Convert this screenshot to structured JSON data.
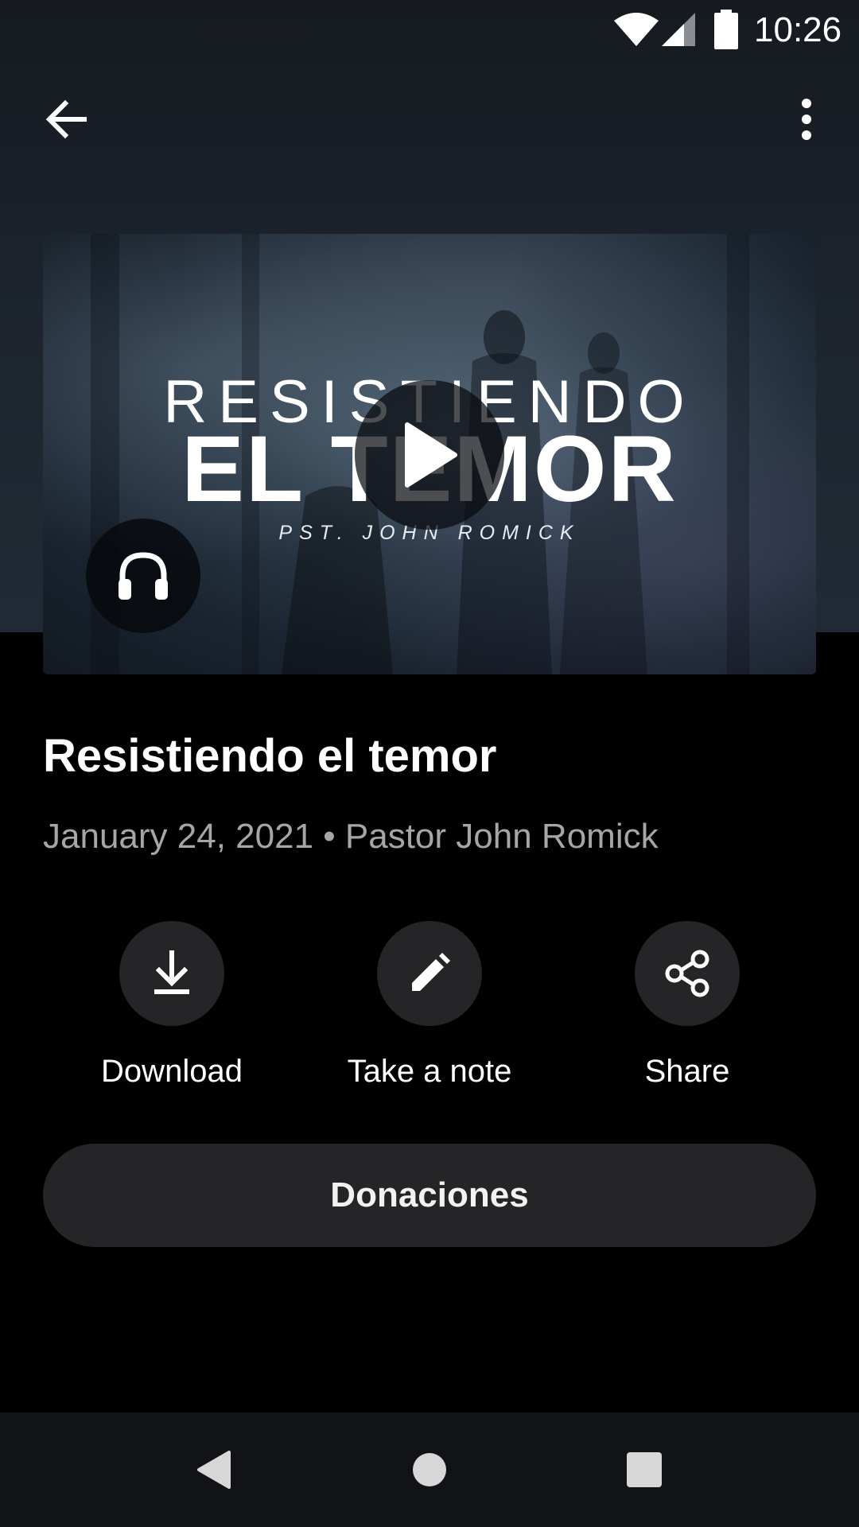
{
  "status_bar": {
    "time": "10:26",
    "icons": [
      "wifi-icon",
      "cellular-signal-icon",
      "battery-icon"
    ]
  },
  "app_bar": {
    "back_icon": "arrow-back-icon",
    "more_icon": "more-vertical-icon"
  },
  "artwork": {
    "title_line_1": "RESISTIENDO",
    "title_line_2": "EL TEMOR",
    "subtitle": "PST. JOHN ROMICK",
    "play_icon": "play-icon",
    "audio_icon": "headphones-icon"
  },
  "sermon": {
    "title": "Resistiendo el temor",
    "meta": "January 24, 2021 • Pastor John Romick"
  },
  "actions": [
    {
      "label": "Download",
      "icon": "download-icon"
    },
    {
      "label": "Take a note",
      "icon": "pencil-icon"
    },
    {
      "label": "Share",
      "icon": "share-icon"
    }
  ],
  "donations": {
    "label": "Donaciones"
  },
  "nav_bar": {
    "icons": [
      "nav-back-icon",
      "nav-home-icon",
      "nav-recents-icon"
    ]
  },
  "colors": {
    "background": "#000000",
    "header_gradient": "#1e2630",
    "button_surface": "#252527",
    "meta_text": "#a6a6a6",
    "nav_bar": "#121317"
  }
}
